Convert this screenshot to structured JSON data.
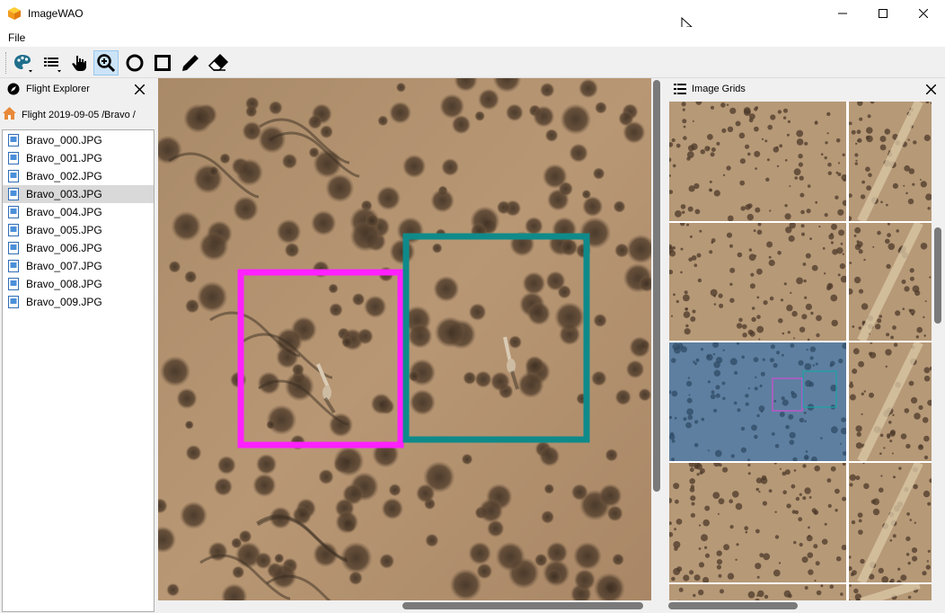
{
  "window": {
    "title": "ImageWAO"
  },
  "menu": {
    "file": "File"
  },
  "toolbar": {
    "tools": [
      "palette-icon",
      "layers-icon",
      "hand-icon",
      "zoom-icon",
      "circle-icon",
      "rectangle-icon",
      "pencil-icon",
      "eraser-icon"
    ],
    "active": "zoom-icon"
  },
  "flight_explorer": {
    "title": "Flight Explorer",
    "breadcrumb": {
      "flight": "Flight 2019-09-05 /",
      "folder": "Bravo /"
    },
    "files": [
      "Bravo_000.JPG",
      "Bravo_001.JPG",
      "Bravo_002.JPG",
      "Bravo_003.JPG",
      "Bravo_004.JPG",
      "Bravo_005.JPG",
      "Bravo_006.JPG",
      "Bravo_007.JPG",
      "Bravo_008.JPG",
      "Bravo_009.JPG"
    ],
    "selected_index": 3
  },
  "image_grids": {
    "title": "Image Grids"
  },
  "colors": {
    "ground": "#b49470",
    "annotation_magenta": "#ff20ff",
    "annotation_teal": "#0f8a8a",
    "selected_tile_tint": "#5e7fa0"
  }
}
